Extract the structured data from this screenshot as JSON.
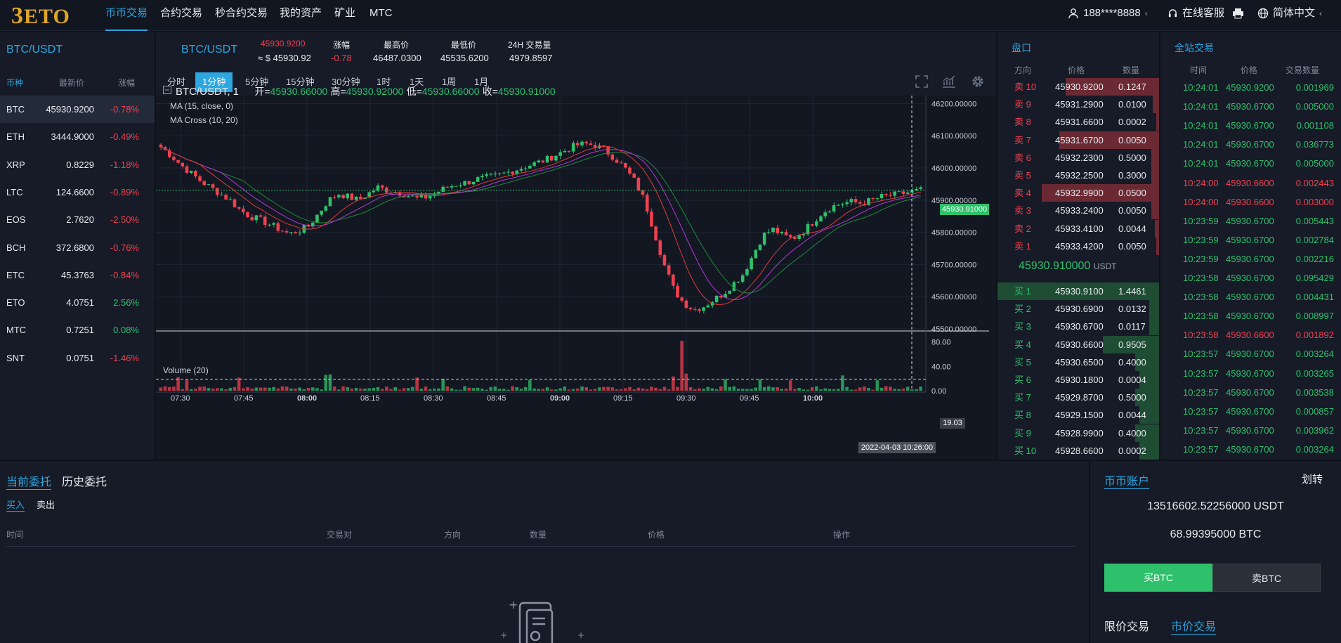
{
  "nav": {
    "logo": "ETO",
    "items": [
      "币币交易",
      "合约交易",
      "秒合约交易",
      "我的资产",
      "矿业",
      "MTC"
    ],
    "user": "188****8888",
    "service": "在线客服",
    "language": "简体中文"
  },
  "markets": {
    "title": "BTC/USDT",
    "headers": [
      "币种",
      "最新价",
      "涨幅"
    ],
    "rows": [
      {
        "coin": "BTC",
        "price": "45930.9200",
        "change": "-0.78%"
      },
      {
        "coin": "ETH",
        "price": "3444.9000",
        "change": "-0.49%"
      },
      {
        "coin": "XRP",
        "price": "0.8229",
        "change": "-1.18%"
      },
      {
        "coin": "LTC",
        "price": "124.6600",
        "change": "-0.89%"
      },
      {
        "coin": "EOS",
        "price": "2.7620",
        "change": "-2.50%"
      },
      {
        "coin": "BCH",
        "price": "372.6800",
        "change": "-0.76%"
      },
      {
        "coin": "ETC",
        "price": "45.3763",
        "change": "-0.84%"
      },
      {
        "coin": "ETO",
        "price": "4.0751",
        "change": "2.56%"
      },
      {
        "coin": "MTC",
        "price": "0.7251",
        "change": "0.08%"
      },
      {
        "coin": "SNT",
        "price": "0.0751",
        "change": "-1.46%"
      }
    ]
  },
  "ticker": {
    "pair": "BTC/USDT",
    "price": "45930.9200",
    "usd": "≈ $ 45930.92",
    "change_label": "涨幅",
    "change": "-0.78",
    "high_label": "最高价",
    "high": "46487.0300",
    "low_label": "最低价",
    "low": "45535.6200",
    "vol_label": "24H 交易量",
    "vol": "4979.8597"
  },
  "timeframes": [
    "分时",
    "1分钟",
    "5分钟",
    "15分钟",
    "30分钟",
    "1时",
    "1天",
    "1周",
    "1月"
  ],
  "chart_info": {
    "symbol": "BTC/USDT, 1",
    "open_label": "开=",
    "open": "45930.66000",
    "high_label": "高=",
    "high": "45930.92000",
    "low_label": "低=",
    "low": "45930.66000",
    "close_label": "收=",
    "close": "45930.91000",
    "ma": "MA (15, close, 0)",
    "macross": "MA Cross (10, 20)",
    "volume": "Volume (20)",
    "last_price_tag": "45930.91000",
    "volume_tag": "19.03",
    "time_tag": "2022-04-03 10:26:00"
  },
  "chart_data": {
    "type": "candlestick",
    "price_ticks": [
      "46200.00000",
      "46100.00000",
      "46000.00000",
      "45900.00000",
      "45800.00000",
      "45700.00000",
      "45600.00000",
      "45500.00000"
    ],
    "volume_ticks": [
      "80.00",
      "40.00",
      "0.00"
    ],
    "time_ticks": [
      "07:30",
      "07:45",
      "08:00",
      "08:15",
      "08:30",
      "08:45",
      "09:00",
      "09:15",
      "09:30",
      "09:45",
      "10:00"
    ],
    "ylim": [
      45500,
      46225
    ],
    "close_path": [
      46065,
      46040,
      46010,
      45985,
      45960,
      45940,
      45920,
      45900,
      45870,
      45850,
      45840,
      45825,
      45810,
      45795,
      45805,
      45820,
      45860,
      45900,
      45920,
      45910,
      45900,
      45920,
      45940,
      45930,
      45925,
      45915,
      45905,
      45910,
      45925,
      45940,
      45950,
      45955,
      45965,
      45970,
      45975,
      45985,
      45995,
      46005,
      46015,
      46025,
      46040,
      46055,
      46070,
      46075,
      46070,
      46055,
      46030,
      46000,
      45960,
      45900,
      45800,
      45700,
      45620,
      45580,
      45560,
      45570,
      45590,
      45610,
      45640,
      45670,
      45730,
      45790,
      45810,
      45790,
      45780,
      45800,
      45830,
      45860,
      45880,
      45890,
      45895,
      45890,
      45900,
      45910,
      45915,
      45920,
      45925,
      45931
    ]
  },
  "orderbook": {
    "title": "盘口",
    "headers": [
      "方向",
      "价格",
      "数量"
    ],
    "asks": [
      {
        "side": "卖 10",
        "price": "45930.9200",
        "qty": "0.1247",
        "depth": 0.7
      },
      {
        "side": "卖 9",
        "price": "45931.2900",
        "qty": "0.0100",
        "depth": 0.05
      },
      {
        "side": "卖 8",
        "price": "45931.6600",
        "qty": "0.0002",
        "depth": 0.02
      },
      {
        "side": "卖 7",
        "price": "45931.6700",
        "qty": "0.0050",
        "depth": 0.75
      },
      {
        "side": "卖 6",
        "price": "45932.2300",
        "qty": "0.5000",
        "depth": 0.06
      },
      {
        "side": "卖 5",
        "price": "45932.2500",
        "qty": "0.3000",
        "depth": 0.06
      },
      {
        "side": "卖 4",
        "price": "45932.9900",
        "qty": "0.0500",
        "depth": 0.88
      },
      {
        "side": "卖 3",
        "price": "45933.2400",
        "qty": "0.0050",
        "depth": 0.06
      },
      {
        "side": "卖 2",
        "price": "45933.4100",
        "qty": "0.0044",
        "depth": 0.03
      },
      {
        "side": "卖 1",
        "price": "45933.4200",
        "qty": "0.0050",
        "depth": 0.02
      }
    ],
    "last_price": "45930.910000",
    "last_unit": "USDT",
    "bids": [
      {
        "side": "买 1",
        "price": "45930.9100",
        "qty": "1.4461",
        "depth": 1.0
      },
      {
        "side": "买 2",
        "price": "45930.6900",
        "qty": "0.0132",
        "depth": 0.06
      },
      {
        "side": "买 3",
        "price": "45930.6700",
        "qty": "0.0117",
        "depth": 0.06
      },
      {
        "side": "买 4",
        "price": "45930.6600",
        "qty": "0.9505",
        "depth": 0.35
      },
      {
        "side": "买 5",
        "price": "45930.6500",
        "qty": "0.4000",
        "depth": 0.15
      },
      {
        "side": "买 6",
        "price": "45930.1800",
        "qty": "0.0004",
        "depth": 0.12
      },
      {
        "side": "买 7",
        "price": "45929.8700",
        "qty": "0.5000",
        "depth": 0.15
      },
      {
        "side": "买 8",
        "price": "45929.1500",
        "qty": "0.0044",
        "depth": 0.12
      },
      {
        "side": "买 9",
        "price": "45928.9900",
        "qty": "0.4000",
        "depth": 0.15
      },
      {
        "side": "买 10",
        "price": "45928.6600",
        "qty": "0.0002",
        "depth": 0.12
      }
    ]
  },
  "trades": {
    "title": "全站交易",
    "headers": [
      "时间",
      "价格",
      "交易数量"
    ],
    "rows": [
      {
        "time": "10:24:01",
        "price": "45930.9200",
        "qty": "0.001969",
        "side": "buy"
      },
      {
        "time": "10:24:01",
        "price": "45930.6700",
        "qty": "0.005000",
        "side": "buy"
      },
      {
        "time": "10:24:01",
        "price": "45930.6700",
        "qty": "0.001108",
        "side": "buy"
      },
      {
        "time": "10:24:01",
        "price": "45930.6700",
        "qty": "0.036773",
        "side": "buy"
      },
      {
        "time": "10:24:01",
        "price": "45930.6700",
        "qty": "0.005000",
        "side": "buy"
      },
      {
        "time": "10:24:00",
        "price": "45930.6600",
        "qty": "0.002443",
        "side": "sell"
      },
      {
        "time": "10:24:00",
        "price": "45930.6600",
        "qty": "0.003000",
        "side": "sell"
      },
      {
        "time": "10:23:59",
        "price": "45930.6700",
        "qty": "0.005443",
        "side": "buy"
      },
      {
        "time": "10:23:59",
        "price": "45930.6700",
        "qty": "0.002784",
        "side": "buy"
      },
      {
        "time": "10:23:59",
        "price": "45930.6700",
        "qty": "0.002216",
        "side": "buy"
      },
      {
        "time": "10:23:58",
        "price": "45930.6700",
        "qty": "0.095429",
        "side": "buy"
      },
      {
        "time": "10:23:58",
        "price": "45930.6700",
        "qty": "0.004431",
        "side": "buy"
      },
      {
        "time": "10:23:58",
        "price": "45930.6700",
        "qty": "0.008997",
        "side": "buy"
      },
      {
        "time": "10:23:58",
        "price": "45930.6600",
        "qty": "0.001892",
        "side": "sell"
      },
      {
        "time": "10:23:57",
        "price": "45930.6700",
        "qty": "0.003264",
        "side": "buy"
      },
      {
        "time": "10:23:57",
        "price": "45930.6700",
        "qty": "0.003265",
        "side": "buy"
      },
      {
        "time": "10:23:57",
        "price": "45930.6700",
        "qty": "0.003538",
        "side": "buy"
      },
      {
        "time": "10:23:57",
        "price": "45930.6700",
        "qty": "0.000857",
        "side": "buy"
      },
      {
        "time": "10:23:57",
        "price": "45930.6700",
        "qty": "0.003962",
        "side": "buy"
      },
      {
        "time": "10:23:57",
        "price": "45930.6700",
        "qty": "0.003264",
        "side": "buy"
      }
    ]
  },
  "orders": {
    "tab_current": "当前委托",
    "tab_history": "历史委托",
    "sub_buy": "买入",
    "sub_sell": "卖出",
    "columns": [
      "时间",
      "交易对",
      "方向",
      "数量",
      "价格",
      "操作"
    ]
  },
  "account": {
    "title": "币币账户",
    "transfer": "划转",
    "usdt": "13516602.52256000 USDT",
    "btc": "68.99395000 BTC",
    "buy_btn": "买BTC",
    "sell_btn": "卖BTC",
    "limit": "限价交易",
    "market": "市价交易"
  },
  "colors": {
    "up": "#2fc06b",
    "down": "#f0404f",
    "accent": "#2ea6e0",
    "logo": "#e0a724"
  }
}
